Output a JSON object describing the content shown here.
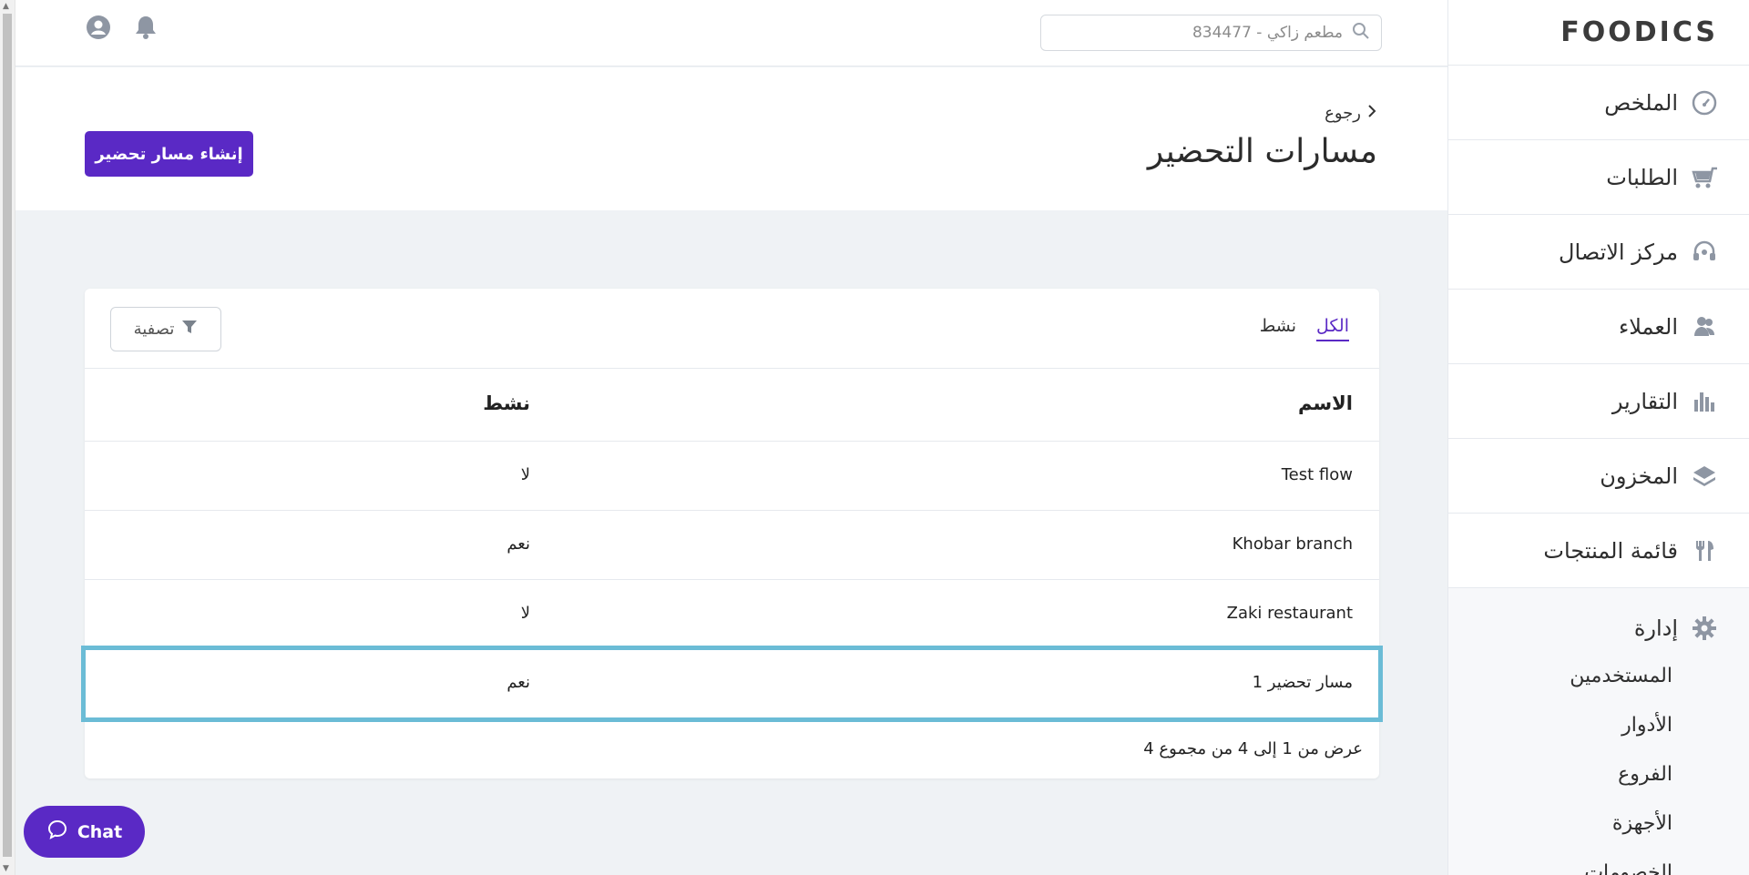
{
  "brand": {
    "logo_text": "FOODICS"
  },
  "topbar": {
    "search_value": "مطعم زاكي - 834477"
  },
  "sidebar": {
    "items": [
      {
        "label": "الملخص",
        "icon": "dashboard-icon"
      },
      {
        "label": "الطلبات",
        "icon": "cart-icon"
      },
      {
        "label": "مركز الاتصال",
        "icon": "headset-icon"
      },
      {
        "label": "العملاء",
        "icon": "customers-icon"
      },
      {
        "label": "التقارير",
        "icon": "reports-icon"
      },
      {
        "label": "المخزون",
        "icon": "inventory-icon"
      },
      {
        "label": "قائمة المنتجات",
        "icon": "menu-icon"
      }
    ],
    "admin": {
      "label": "إدارة",
      "icon": "gear-icon",
      "subitems": [
        "المستخدمين",
        "الأدوار",
        "الفروع",
        "الأجهزة",
        "الخصومات"
      ]
    }
  },
  "page": {
    "back_label": "رجوع",
    "title": "مسارات التحضير",
    "create_button": "إنشاء مسار تحضير"
  },
  "card": {
    "tabs": [
      {
        "label": "الكل",
        "active": true
      },
      {
        "label": "نشط",
        "active": false
      }
    ],
    "filter_label": "تصفية",
    "columns": {
      "name": "الاسم",
      "active": "نشط"
    },
    "rows": [
      {
        "name": "Test flow",
        "active": "لا"
      },
      {
        "name": "Khobar branch",
        "active": "نعم"
      },
      {
        "name": "Zaki restaurant",
        "active": "لا"
      },
      {
        "name": "مسار تحضير 1",
        "active": "نعم"
      }
    ],
    "pagination": "عرض من 1 إلى 4 من مجموع 4"
  },
  "chat": {
    "label": "Chat"
  },
  "colors": {
    "accent": "#5a29c5",
    "highlight": "#6bbcd6"
  }
}
